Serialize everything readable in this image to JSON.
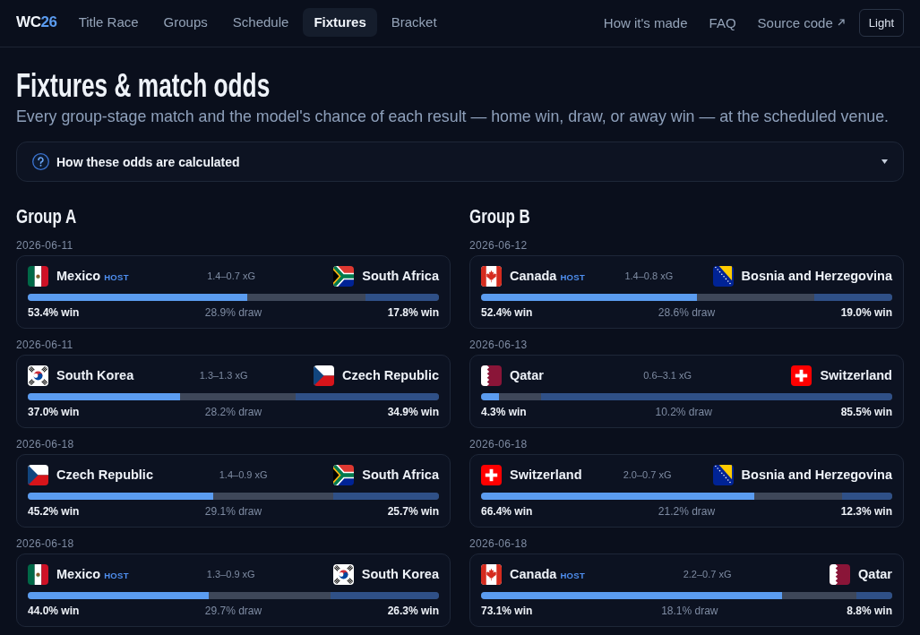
{
  "nav": {
    "logo": {
      "text": "WC",
      "accent": "26"
    },
    "items": [
      {
        "label": "Title Race",
        "selected": false
      },
      {
        "label": "Groups",
        "selected": false
      },
      {
        "label": "Schedule",
        "selected": false
      },
      {
        "label": "Fixtures",
        "selected": true
      },
      {
        "label": "Bracket",
        "selected": false
      }
    ],
    "links": [
      {
        "label": "How it's made",
        "external": false
      },
      {
        "label": "FAQ",
        "external": false
      },
      {
        "label": "Source code",
        "external": true
      }
    ],
    "theme_button": "Light"
  },
  "page": {
    "title": "Fixtures & match odds",
    "subtitle": "Every group-stage match and the model's chance of each result — home win, draw, or away win — at the scheduled venue."
  },
  "explainer": {
    "label": "How these odds are calculated",
    "expanded": false
  },
  "groups": [
    {
      "name": "Group A",
      "matches": [
        {
          "date": "2026-06-11",
          "home": {
            "team": "Mexico",
            "badge": "HOST",
            "kind": "mexico"
          },
          "xg": "1.4–0.7 xG",
          "away": {
            "team": "South Africa",
            "kind": "south_africa"
          },
          "outcomes": [
            {
              "kind": "home",
              "level": 0.534,
              "label": "53.4% win"
            },
            {
              "kind": "draw",
              "label": "28.9% draw"
            },
            {
              "kind": "away",
              "level": 0.178,
              "label": "17.8% win"
            }
          ]
        },
        {
          "date": "2026-06-11",
          "home": {
            "team": "South Korea",
            "kind": "south_korea"
          },
          "xg": "1.3–1.3 xG",
          "away": {
            "team": "Czech Republic",
            "kind": "czech_republic"
          },
          "outcomes": [
            {
              "kind": "home",
              "level": 0.37,
              "label": "37.0% win"
            },
            {
              "kind": "draw",
              "label": "28.2% draw"
            },
            {
              "kind": "away",
              "level": 0.349,
              "label": "34.9% win"
            }
          ]
        },
        {
          "date": "2026-06-18",
          "home": {
            "team": "Czech Republic",
            "kind": "czech_republic"
          },
          "xg": "1.4–0.9 xG",
          "away": {
            "team": "South Africa",
            "kind": "south_africa"
          },
          "outcomes": [
            {
              "kind": "home",
              "level": 0.452,
              "label": "45.2% win"
            },
            {
              "kind": "draw",
              "label": "29.1% draw"
            },
            {
              "kind": "away",
              "level": 0.257,
              "label": "25.7% win"
            }
          ]
        },
        {
          "date": "2026-06-18",
          "home": {
            "team": "Mexico",
            "badge": "HOST",
            "kind": "mexico"
          },
          "xg": "1.3–0.9 xG",
          "away": {
            "team": "South Korea",
            "kind": "south_korea"
          },
          "outcomes": [
            {
              "kind": "home",
              "level": 0.44,
              "label": "44.0% win"
            },
            {
              "kind": "draw",
              "label": "29.7% draw"
            },
            {
              "kind": "away",
              "level": 0.263,
              "label": "26.3% win"
            }
          ]
        }
      ]
    },
    {
      "name": "Group B",
      "matches": [
        {
          "date": "2026-06-12",
          "home": {
            "team": "Canada",
            "badge": "HOST",
            "kind": "canada"
          },
          "xg": "1.4–0.8 xG",
          "away": {
            "team": "Bosnia and Herzegovina",
            "kind": "bosnia_and_herzegovina"
          },
          "outcomes": [
            {
              "kind": "home",
              "level": 0.524,
              "label": "52.4% win"
            },
            {
              "kind": "draw",
              "label": "28.6% draw"
            },
            {
              "kind": "away",
              "level": 0.19,
              "label": "19.0% win"
            }
          ]
        },
        {
          "date": "2026-06-13",
          "home": {
            "team": "Qatar",
            "kind": "qatar"
          },
          "xg": "0.6–3.1 xG",
          "away": {
            "team": "Switzerland",
            "kind": "switzerland"
          },
          "outcomes": [
            {
              "kind": "home",
              "level": 0.043,
              "label": "4.3% win"
            },
            {
              "kind": "draw",
              "label": "10.2% draw"
            },
            {
              "kind": "away",
              "level": 0.855,
              "label": "85.5% win"
            }
          ]
        },
        {
          "date": "2026-06-18",
          "home": {
            "team": "Switzerland",
            "kind": "switzerland"
          },
          "xg": "2.0–0.7 xG",
          "away": {
            "team": "Bosnia and Herzegovina",
            "kind": "bosnia_and_herzegovina"
          },
          "outcomes": [
            {
              "kind": "home",
              "level": 0.664,
              "label": "66.4% win"
            },
            {
              "kind": "draw",
              "label": "21.2% draw"
            },
            {
              "kind": "away",
              "level": 0.123,
              "label": "12.3% win"
            }
          ]
        },
        {
          "date": "2026-06-18",
          "home": {
            "team": "Canada",
            "badge": "HOST",
            "kind": "canada"
          },
          "xg": "2.2–0.7 xG",
          "away": {
            "team": "Qatar",
            "kind": "qatar"
          },
          "outcomes": [
            {
              "kind": "home",
              "level": 0.731,
              "label": "73.1% win"
            },
            {
              "kind": "draw",
              "label": "18.1% draw"
            },
            {
              "kind": "away",
              "level": 0.088,
              "label": "8.8% win"
            }
          ]
        }
      ]
    }
  ]
}
